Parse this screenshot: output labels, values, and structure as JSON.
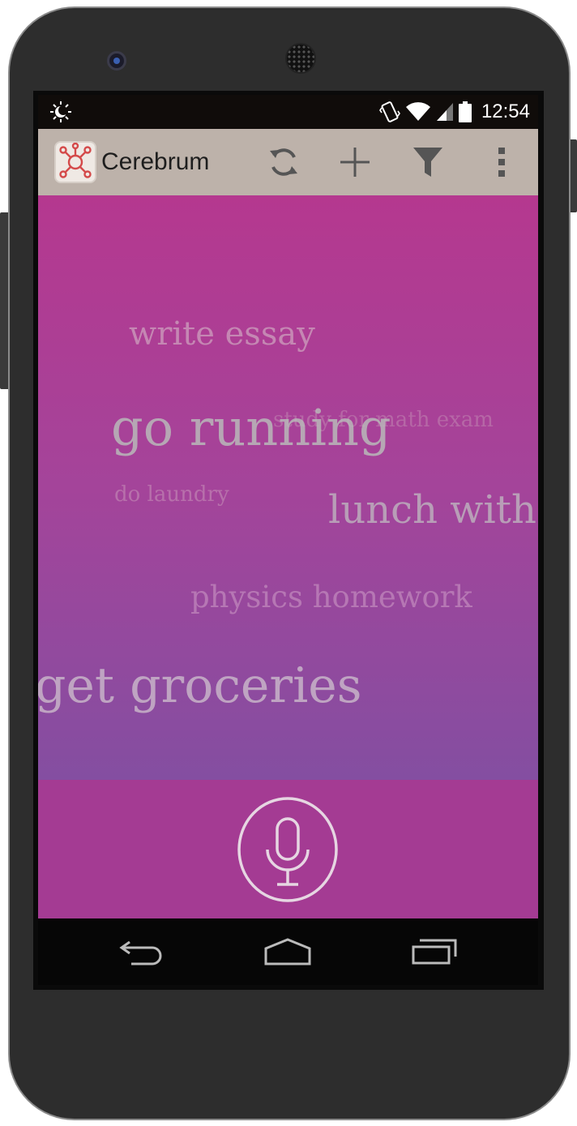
{
  "status_bar": {
    "time": "12:54",
    "icons": [
      "brightness-icon",
      "vibrate-icon",
      "wifi-icon",
      "signal-icon",
      "battery-icon"
    ]
  },
  "action_bar": {
    "app_icon": "cerebrum-logo-icon",
    "title": "Cerebrum",
    "actions": [
      "refresh-icon",
      "add-icon",
      "filter-icon",
      "overflow-menu-icon"
    ]
  },
  "tasks": [
    {
      "text": "write essay"
    },
    {
      "text": "go running"
    },
    {
      "text": "study for math exam"
    },
    {
      "text": "do laundry"
    },
    {
      "text": "lunch with"
    },
    {
      "text": "physics homework"
    },
    {
      "text": "get groceries"
    }
  ],
  "mic": {
    "icon": "microphone-icon"
  },
  "nav_bar": {
    "icons": [
      "back-icon",
      "home-icon",
      "recent-apps-icon"
    ]
  },
  "colors": {
    "status_bar": "#100c0a",
    "action_bar": "#bdb2aa",
    "content_top": "#b5388f",
    "content_bottom": "#844ea1",
    "mic_bar": "#a43b93",
    "nav_bar": "#060606",
    "word": "#b8a0b8",
    "mic_outline": "#e6d6e2",
    "app_icon_accent": "#d44a4a"
  }
}
